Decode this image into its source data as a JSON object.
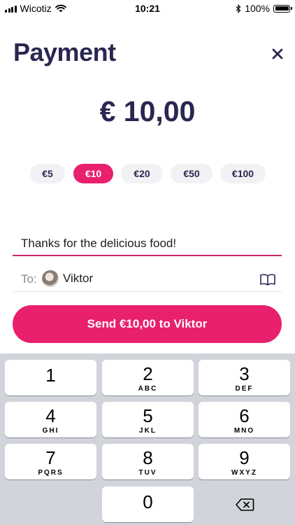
{
  "status_bar": {
    "carrier": "Wicotiz",
    "time": "10:21",
    "battery_text": "100%",
    "battery_level": 1.0
  },
  "header": {
    "title": "Payment"
  },
  "amount": {
    "display": "€ 10,00"
  },
  "presets": [
    {
      "label": "€5",
      "selected": false
    },
    {
      "label": "€10",
      "selected": true
    },
    {
      "label": "€20",
      "selected": false
    },
    {
      "label": "€50",
      "selected": false
    },
    {
      "label": "€100",
      "selected": false
    }
  ],
  "message": {
    "value": "Thanks for the delicious food!"
  },
  "recipient": {
    "to_label": "To:",
    "name": "Viktor"
  },
  "send_button": {
    "label": "Send €10,00 to Viktor"
  },
  "keypad": {
    "keys": [
      {
        "num": "1",
        "letters": ""
      },
      {
        "num": "2",
        "letters": "ABC"
      },
      {
        "num": "3",
        "letters": "DEF"
      },
      {
        "num": "4",
        "letters": "GHI"
      },
      {
        "num": "5",
        "letters": "JKL"
      },
      {
        "num": "6",
        "letters": "MNO"
      },
      {
        "num": "7",
        "letters": "PQRS"
      },
      {
        "num": "8",
        "letters": "TUV"
      },
      {
        "num": "9",
        "letters": "WXYZ"
      },
      {
        "num": "0",
        "letters": ""
      }
    ]
  },
  "colors": {
    "accent": "#e8206e",
    "title": "#2a2752",
    "chip_bg": "#f2f2f5",
    "keypad_bg": "#d1d4da"
  },
  "icons": [
    "cellular-signal-icon",
    "wifi-icon",
    "bluetooth-icon",
    "battery-icon",
    "close-icon",
    "address-book-icon",
    "backspace-icon"
  ]
}
